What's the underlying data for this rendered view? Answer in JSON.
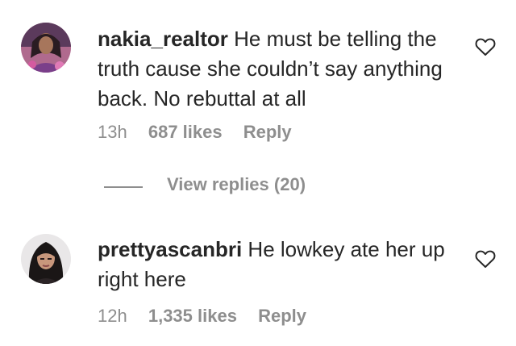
{
  "comments": [
    {
      "username": "nakia_realtor",
      "text": "He must be telling the truth cause she couldn’t say anything back. No rebuttal at all",
      "time": "13h",
      "likes": "687 likes",
      "reply": "Reply",
      "avatar_icon": "profile-photo",
      "like_icon": "heart-outline-icon"
    },
    {
      "username": "prettyascanbri",
      "text": "He lowkey ate her up right here",
      "time": "12h",
      "likes": "1,335 likes",
      "reply": "Reply",
      "avatar_icon": "profile-photo",
      "like_icon": "heart-outline-icon"
    }
  ],
  "view_replies": "View replies (20)",
  "colors": {
    "text": "#262626",
    "secondary": "#8e8e8e",
    "background": "#ffffff"
  }
}
